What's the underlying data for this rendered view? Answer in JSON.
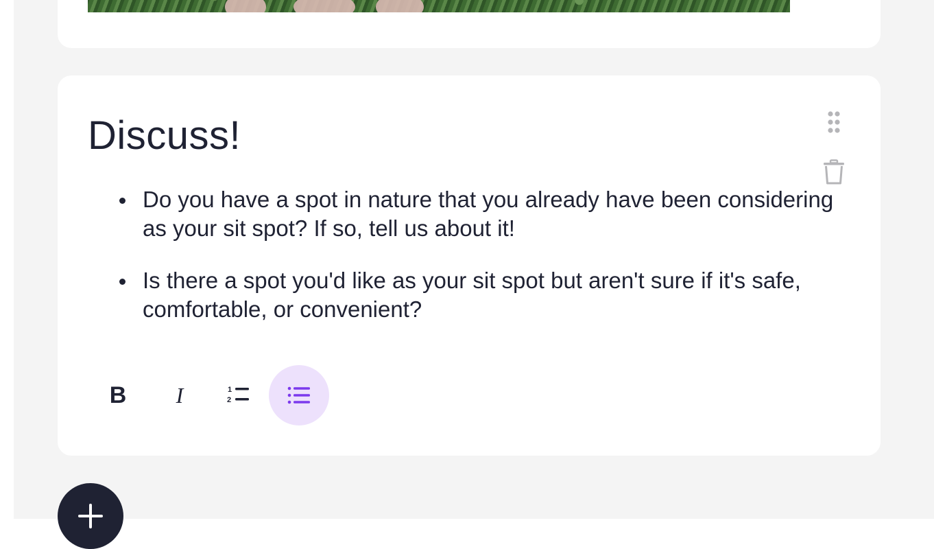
{
  "discussion_card": {
    "title": "Discuss!",
    "bullets": [
      "Do you have a spot in nature that you already have been considering as your sit spot? If so, tell us about it!",
      "Is there a spot you'd like as your sit spot but aren't sure if it's safe, comfortable, or convenient?"
    ]
  },
  "toolbar": {
    "bold_label": "B",
    "italic_label": "I",
    "ordered_list_icon": "ordered-list-icon",
    "bullet_list_icon": "bullet-list-icon",
    "active": "bullet-list"
  },
  "icons": {
    "drag": "drag-handle-icon",
    "delete": "trash-icon",
    "add": "plus-icon"
  },
  "colors": {
    "page_background": "#f4f4f4",
    "card_background": "#ffffff",
    "text": "#1f2233",
    "accent": "#7c3aed",
    "accent_soft": "#ede1fc",
    "icon_muted": "#b5b5b8"
  }
}
